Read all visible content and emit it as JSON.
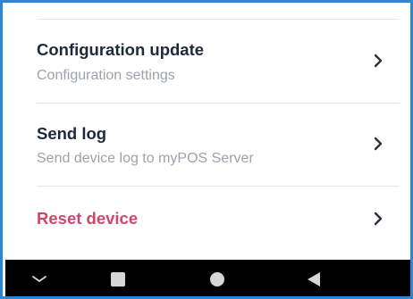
{
  "menu": {
    "items": [
      {
        "title": "Configuration update",
        "subtitle": "Configuration settings",
        "chevron_icon": "chevron-right-icon"
      },
      {
        "title": "Send log",
        "subtitle": "Send device log to myPOS Server",
        "chevron_icon": "chevron-right-icon"
      },
      {
        "title": "Reset device",
        "chevron_icon": "chevron-right-icon"
      }
    ]
  },
  "navbar": {
    "buttons": [
      {
        "icon": "hide-keyboard-icon"
      },
      {
        "icon": "recents-square-icon"
      },
      {
        "icon": "home-circle-icon"
      },
      {
        "icon": "back-triangle-icon"
      }
    ]
  },
  "colors": {
    "frame_border": "#2b86d6",
    "title_text": "#1e2a3a",
    "subtitle_text": "#9aa3ad",
    "danger_text": "#d1466b",
    "divider": "#e6e6e6",
    "navbar_bg": "#000000",
    "navbar_icon": "#d6d6d6"
  }
}
